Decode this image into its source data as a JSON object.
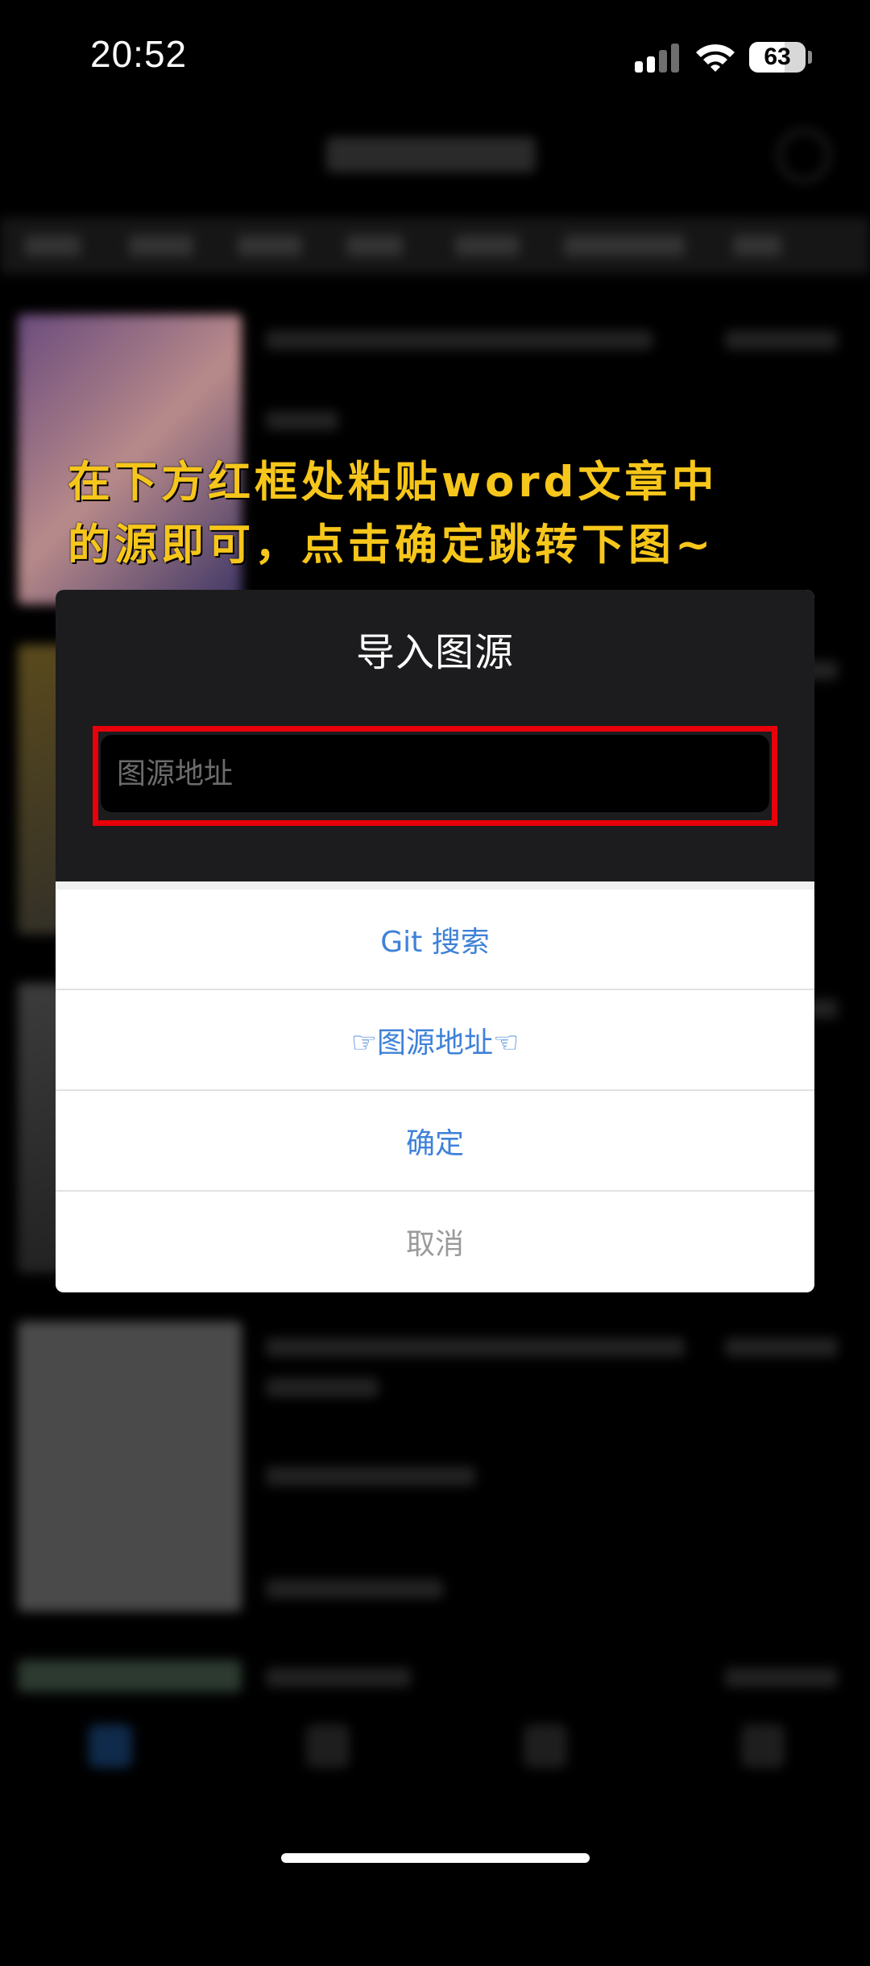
{
  "status_bar": {
    "time": "20:52",
    "battery_percent": "63",
    "battery_level": 0.63
  },
  "annotation": {
    "line1": "在下方红框处粘贴word文章中",
    "line2": "的源即可，点击确定跳转下图~",
    "color": "#f6c61b"
  },
  "dialog": {
    "title": "导入图源",
    "input_placeholder": "图源地址",
    "input_value": "",
    "highlight_color": "#e8000a",
    "buttons": {
      "git_search": "Git 搜索",
      "source_address": "☞图源地址☜",
      "confirm": "确定",
      "cancel": "取消"
    },
    "button_color": "#3f82d8"
  },
  "icons": [
    "signal-icon",
    "wifi-icon",
    "battery-icon"
  ]
}
